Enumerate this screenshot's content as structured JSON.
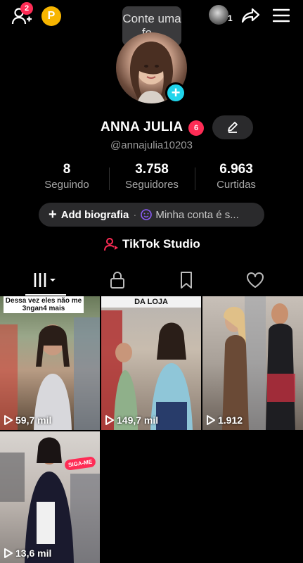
{
  "header": {
    "friend_requests_count": "2",
    "coin_label": "P",
    "tooltip_text": "Conte uma fo...",
    "live_count": "1"
  },
  "profile": {
    "name": "ANNA JULIA",
    "name_badge": "6",
    "handle": "@annajulia10203",
    "stats": [
      {
        "value": "8",
        "label": "Seguindo"
      },
      {
        "value": "3.758",
        "label": "Seguidores"
      },
      {
        "value": "6.963",
        "label": "Curtidas"
      }
    ],
    "bio_button": "Add biografia",
    "account_text": "Minha conta é s...",
    "studio_label": "TikTok Studio"
  },
  "tabs": [
    {
      "name": "videos",
      "icon": "grid-icon"
    },
    {
      "name": "private",
      "icon": "lock-icon"
    },
    {
      "name": "saved",
      "icon": "bookmark-icon"
    },
    {
      "name": "liked",
      "icon": "heart-icon"
    }
  ],
  "videos": [
    {
      "caption": "Dessa vez eles não me 3ngan4 mais",
      "views": "59,7 mil"
    },
    {
      "caption": "DA LOJA",
      "views": "149,7 mil"
    },
    {
      "caption": "",
      "views": "1.912"
    },
    {
      "caption": "SIGA-ME",
      "views": "13,6 mil"
    }
  ],
  "colors": {
    "accent_red": "#fe2c55",
    "accent_cyan": "#20d5ec",
    "coin_yellow": "#f7b500",
    "pill_bg": "#2a2a2c"
  }
}
